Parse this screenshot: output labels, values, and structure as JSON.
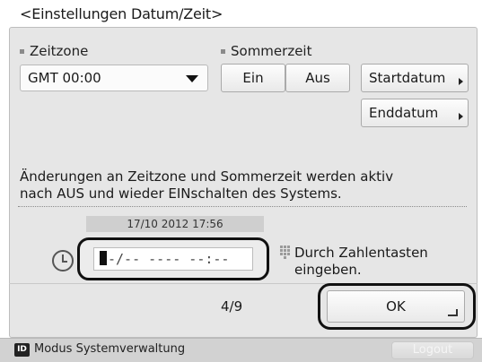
{
  "screen": {
    "title": "<Einstellungen Datum/Zeit>"
  },
  "timezone": {
    "label": "Zeitzone",
    "value": "GMT 00:00"
  },
  "dst": {
    "label": "Sommerzeit",
    "on_label": "Ein",
    "off_label": "Aus",
    "start_label": "Startdatum",
    "end_label": "Enddatum"
  },
  "info": {
    "line1": "Änderungen an Zeitzone und Sommerzeit werden aktiv",
    "line2": "nach AUS und wieder EINschalten des Systems."
  },
  "datetime": {
    "current": "17/10 2012 17:56",
    "entry_value": "-/-- ---- --:--",
    "hint_line1": "Durch Zahlentasten",
    "hint_line2": "eingeben."
  },
  "pagination": {
    "text": "4/9"
  },
  "actions": {
    "ok_label": "OK"
  },
  "statusbar": {
    "badge": "ID",
    "mode": "Modus Systemverwaltung",
    "logout": "Logout"
  },
  "icons": {
    "timezone_dropdown": "chevron-down-icon",
    "clock": "clock-icon",
    "keypad": "keypad-icon",
    "enter": "enter-icon"
  }
}
